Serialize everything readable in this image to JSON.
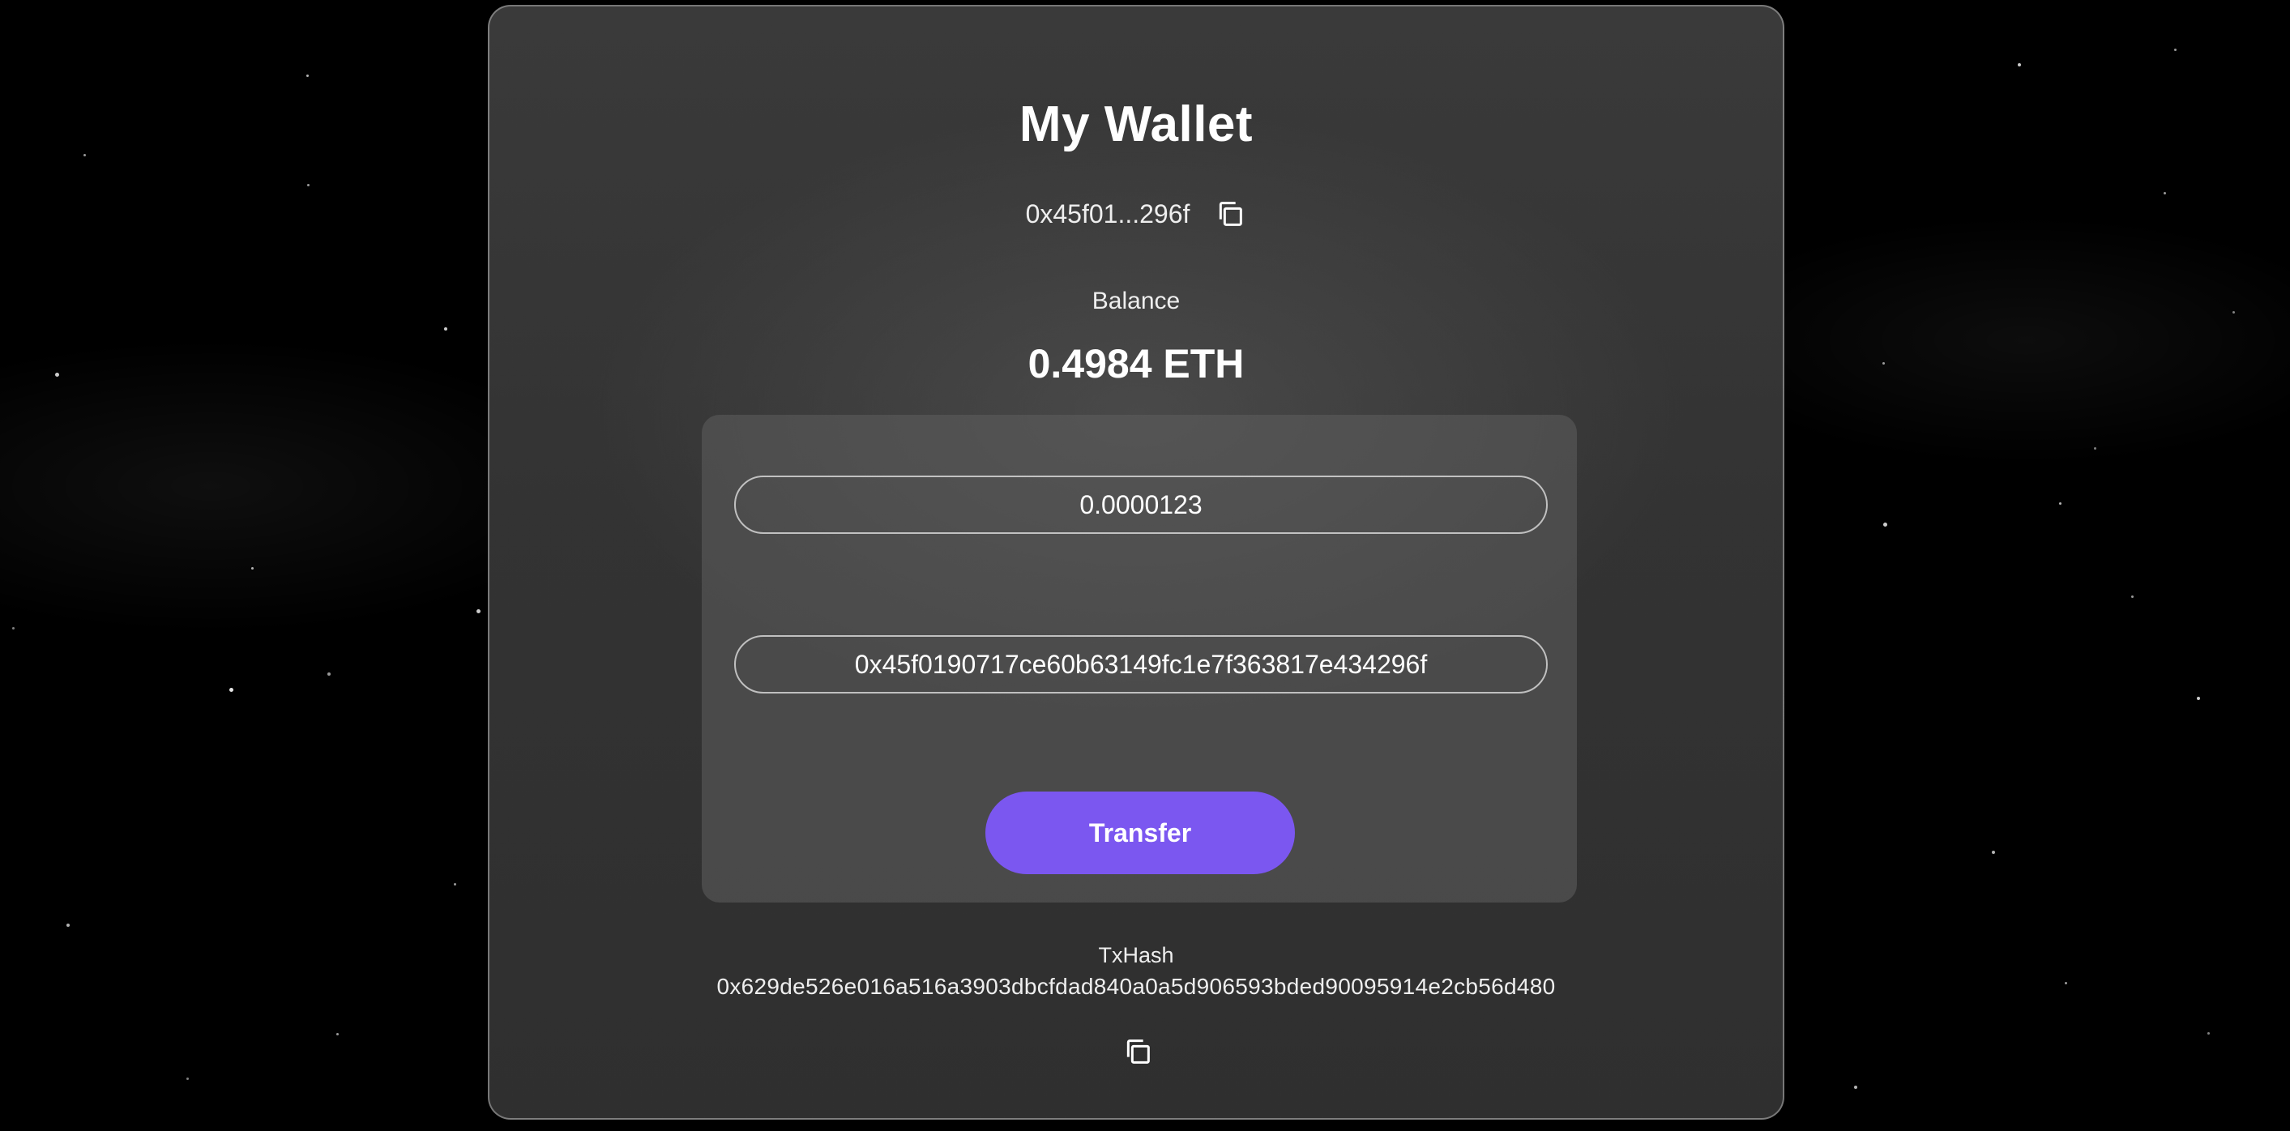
{
  "wallet": {
    "title": "My Wallet",
    "address_short": "0x45f01...296f",
    "balance_label": "Balance",
    "balance_value": "0.4984 ETH"
  },
  "transfer_form": {
    "amount_value": "0.0000123",
    "recipient_value": "0x45f0190717ce60b63149fc1e7f363817e434296f",
    "transfer_label": "Transfer"
  },
  "transaction": {
    "label": "TxHash",
    "hash": "0x629de526e016a516a3903dbcfdad840a0a5d906593bded90095914e2cb56d480"
  },
  "icons": {
    "address_copy": "copy-icon",
    "txhash_copy": "copy-icon"
  },
  "colors": {
    "accent": "#7b57f0",
    "background": "#000000",
    "card": "#363636"
  }
}
